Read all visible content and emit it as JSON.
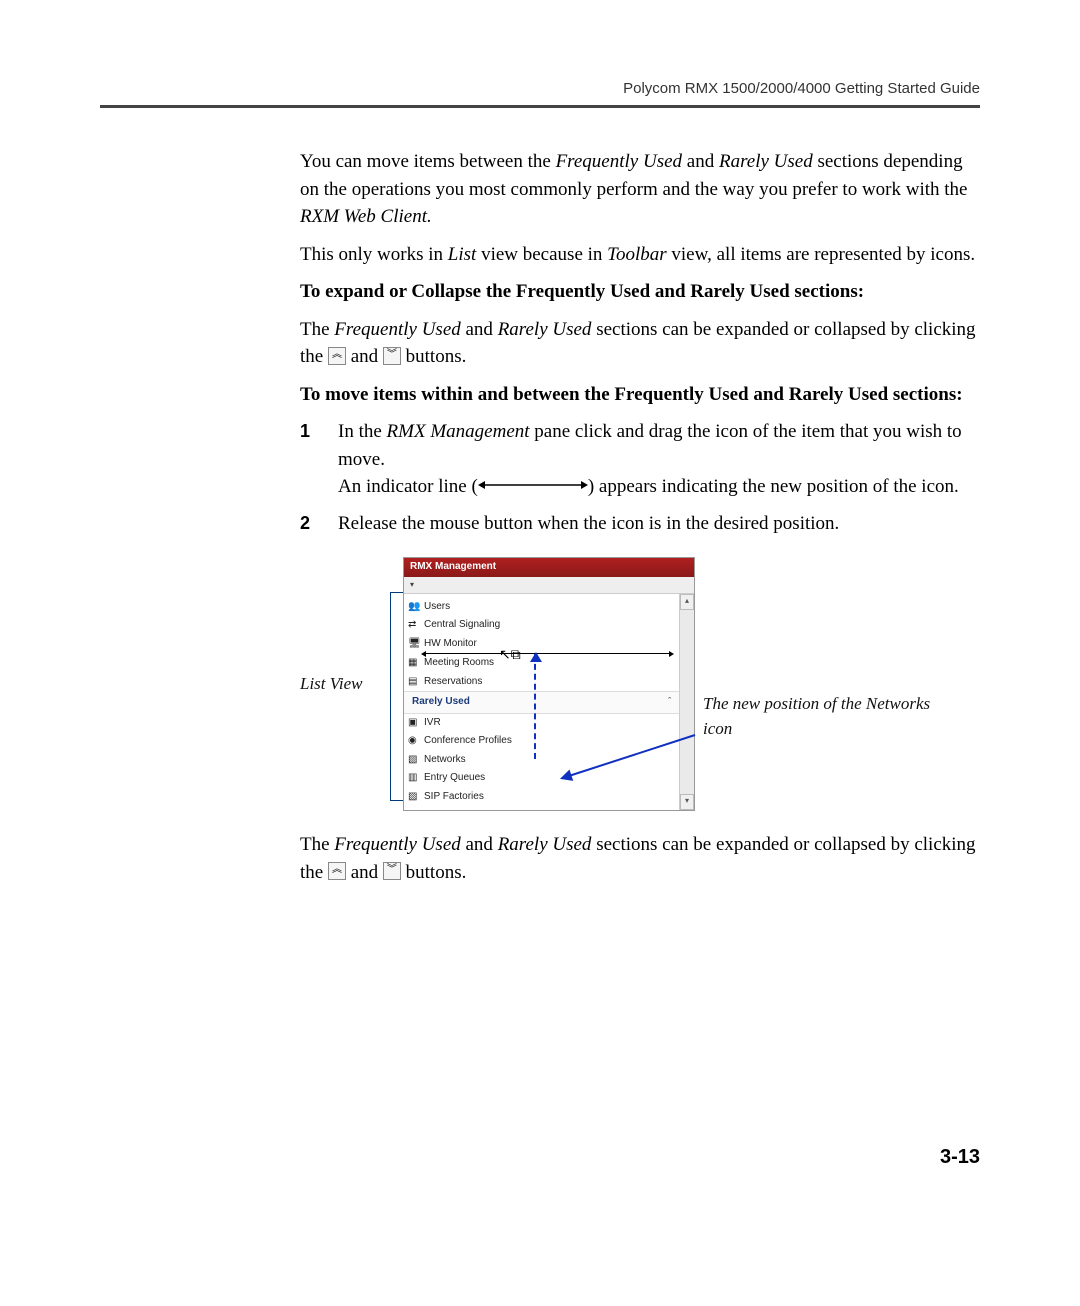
{
  "header": "Polycom RMX 1500/2000/4000 Getting Started Guide",
  "p1a": "You can move items between the ",
  "p1b": "Frequently Used",
  "p1c": " and ",
  "p1d": "Rarely Used",
  "p1e": " sections depending on the operations you most commonly perform and the way you prefer to work with the ",
  "p1f": "RXM Web Client.",
  "p2a": "This only works in ",
  "p2b": "List",
  "p2c": " view because in ",
  "p2d": "Toolbar",
  "p2e": " view, all items are represented by icons.",
  "h1": "To expand or Collapse the Frequently Used and Rarely Used sections:",
  "p3a": "The ",
  "p3b": "Frequently Used",
  "p3c": " and ",
  "p3d": "Rarely Used",
  "p3e": " sections can be expanded or collapsed by clicking the ",
  "p3f": " and ",
  "p3g": " buttons.",
  "h2": "To move items within and between the Frequently Used and Rarely Used sections:",
  "steps": {
    "n1": "1",
    "s1a": "In the ",
    "s1b": "RMX Management",
    "s1c": " pane click and drag the icon of the item that you wish to move.",
    "s1d": "An indicator line (",
    "s1e": ") appears indicating the new position of the icon.",
    "n2": "2",
    "s2": "Release the mouse button when the icon is in the desired position."
  },
  "figure": {
    "left_label": "List View",
    "panel_title": "RMX Management",
    "rarely_header": "Rarely Used",
    "items_top": [
      "Users",
      "Central Signaling",
      "HW Monitor"
    ],
    "items_mid": [
      "Meeting Rooms",
      "Reservations"
    ],
    "items_bot": [
      "IVR",
      "Conference Profiles",
      "Networks",
      "Entry Queues",
      "SIP Factories"
    ],
    "callout": "The new position of the Networks icon"
  },
  "p4a": "The ",
  "p4b": "Frequently Used",
  "p4c": " and ",
  "p4d": "Rarely Used",
  "p4e": " sections can be expanded or collapsed by clicking the ",
  "p4f": " and ",
  "p4g": " buttons.",
  "page_num": "3-13",
  "glyphs": {
    "up": "︽",
    "down": "︾",
    "toolbar": "▾",
    "collapse": "ˆ"
  }
}
